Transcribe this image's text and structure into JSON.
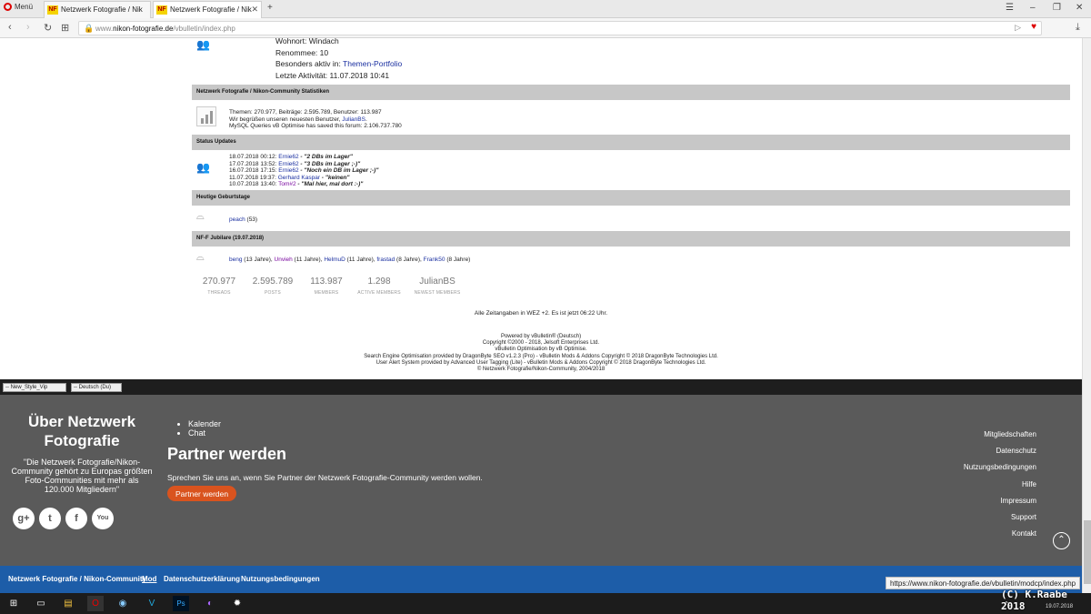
{
  "browser": {
    "menu_label": "Menü",
    "tabs": [
      {
        "label": "Netzwerk Fotografie / Nik"
      },
      {
        "label": "Netzwerk Fotografie / Nik"
      }
    ],
    "new_tab": "+",
    "url_prefix": "www.",
    "url_host": "nikon-fotografie.de",
    "url_path": "/vbulletin/index.php"
  },
  "profile": {
    "wohnort": "Wohnort: Windach",
    "renommee": "Renommee: 10",
    "besonders_label": "Besonders aktiv in: ",
    "besonders_link": "Themen-Portfolio",
    "letzte": "Letzte Aktivität: 11.07.2018 10:41"
  },
  "stats_section": {
    "title": "Netzwerk Fotografie / Nikon-Community Statistiken",
    "line1": "Themen: 270.977, Beiträge: 2.595.789, Benutzer: 113.987",
    "line2_prefix": "Wir begrüßen unseren neuesten Benutzer, ",
    "line2_user": "JulianBS",
    "line2_suffix": ".",
    "line3": "MySQL Queries vB Optimise has saved this forum: 2.106.737.780"
  },
  "status_updates": {
    "title": "Status Updates",
    "items": [
      {
        "time": "18.07.2018 00:12: ",
        "user": "Ernie62",
        "msg": " - \"2 DBs im Lager\""
      },
      {
        "time": "17.07.2018 13:52: ",
        "user": "Ernie62",
        "msg": " - \"3 DBs im Lager ;-)\""
      },
      {
        "time": "16.07.2018 17:15: ",
        "user": "Ernie62",
        "msg": " - \"Noch ein DB im Lager ;-)\""
      },
      {
        "time": "11.07.2018 19:37: ",
        "user": "Gerhard Kaspar",
        "msg": " - \"keinen\""
      },
      {
        "time": "10.07.2018 13:40: ",
        "user": "Tom#2",
        "msg": " - \"Mal hier, mal dort :-)\""
      }
    ]
  },
  "birthdays": {
    "title": "Heutige Geburtstage",
    "user": "peach",
    "age": " (53)"
  },
  "jubilare": {
    "title": "NF-F Jubilare (19.07.2018)",
    "items": [
      {
        "user": "beng",
        "years": " (13 Jahre), "
      },
      {
        "user": "Unvieh",
        "years": " (11 Jahre), "
      },
      {
        "user": "HelmuD",
        "years": " (11 Jahre), "
      },
      {
        "user": "frastad",
        "years": " (8 Jahre), "
      },
      {
        "user": "Frank50",
        "years": " (8 Jahre)"
      }
    ]
  },
  "summary": [
    {
      "num": "270.977",
      "label": "THREADS"
    },
    {
      "num": "2.595.789",
      "label": "POSTS"
    },
    {
      "num": "113.987",
      "label": "MEMBERS"
    },
    {
      "num": "1.298",
      "label": "ACTIVE MEMBERS"
    },
    {
      "num": "JulianBS",
      "label": "NEWEST MEMBERS"
    }
  ],
  "timezone": "Alle Zeitangaben in WEZ +2. Es ist jetzt 06:22 Uhr.",
  "credits": [
    "Powered by vBulletin® (Deutsch)",
    "Copyright ©2000 - 2018, Jelsoft Enterprises Ltd.",
    "vBulletin Optimisation by vB Optimise.",
    "Search Engine Optimisation provided by DragonByte SEO v1.2.3 (Pro) - vBulletin Mods & Addons Copyright © 2018 DragonByte Technologies Ltd.",
    "User Alert System provided by Advanced User Tagging (Lite) - vBulletin Mods & Addons Copyright © 2018 DragonByte Technologies Ltd.",
    "© Netzwerk Fotografie/Nikon-Community, 2004/2018"
  ],
  "selects": {
    "style": "-- New_Style_Vip",
    "language": "-- Deutsch (Du)"
  },
  "footer": {
    "about_title": "Über Netzwerk Fotografie",
    "about_quote": "\"Die Netzwerk Fotografie/Nikon-Community gehört zu Europas größten Foto-Communities mit mehr als 120.000 Mitgliedern\"",
    "social": [
      "g+",
      "t",
      "f",
      "You"
    ],
    "quicklinks": [
      "Kalender",
      "Chat"
    ],
    "partner_title": "Partner werden",
    "partner_text": "Sprechen Sie uns an, wenn Sie Partner der Netzwerk Fotografie-Community werden wollen.",
    "partner_button": "Partner werden",
    "right_links": [
      "Mitgliedschaften",
      "Datenschutz",
      "Nutzungsbedingungen",
      "Hilfe",
      "Impressum",
      "Support",
      "Kontakt"
    ],
    "bottom_links": [
      "Netzwerk Fotografie / Nikon-Community",
      "Mod",
      "Datenschutzerklärung",
      "Nutzungsbedingungen"
    ]
  },
  "status_url": "https://www.nikon-fotografie.de/vbulletin/modcp/index.php",
  "taskbar": {
    "copyright": "(C) K.Raabe 2018",
    "date": "19.07.2018"
  }
}
